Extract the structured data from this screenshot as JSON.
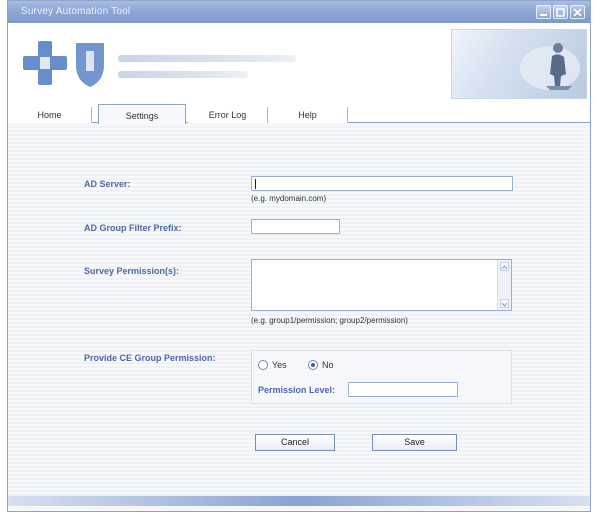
{
  "window": {
    "title": "Survey Automation Tool"
  },
  "tabs": [
    {
      "label": "Home"
    },
    {
      "label": "Settings"
    },
    {
      "label": "Error Log"
    },
    {
      "label": "Help"
    }
  ],
  "form": {
    "ad_server": {
      "label": "AD Server:",
      "value": "",
      "hint": "(e.g. mydomain.com)"
    },
    "ad_group_prefix": {
      "label": "AD Group Filter Prefix:",
      "value": ""
    },
    "survey_permissions": {
      "label": "Survey Permission(s):",
      "value": "",
      "hint": "(e.g. group1/permission; group2/permission)"
    },
    "ce_group_permission": {
      "label": "Provide CE Group Permission:",
      "options": [
        "Yes",
        "No"
      ],
      "selected": "No",
      "permission_level_label": "Permission Level:",
      "permission_level_value": ""
    }
  },
  "buttons": {
    "cancel": "Cancel",
    "save": "Save"
  },
  "colors": {
    "accent": "#4d6aa8",
    "titlebar": "#8da6d6"
  }
}
